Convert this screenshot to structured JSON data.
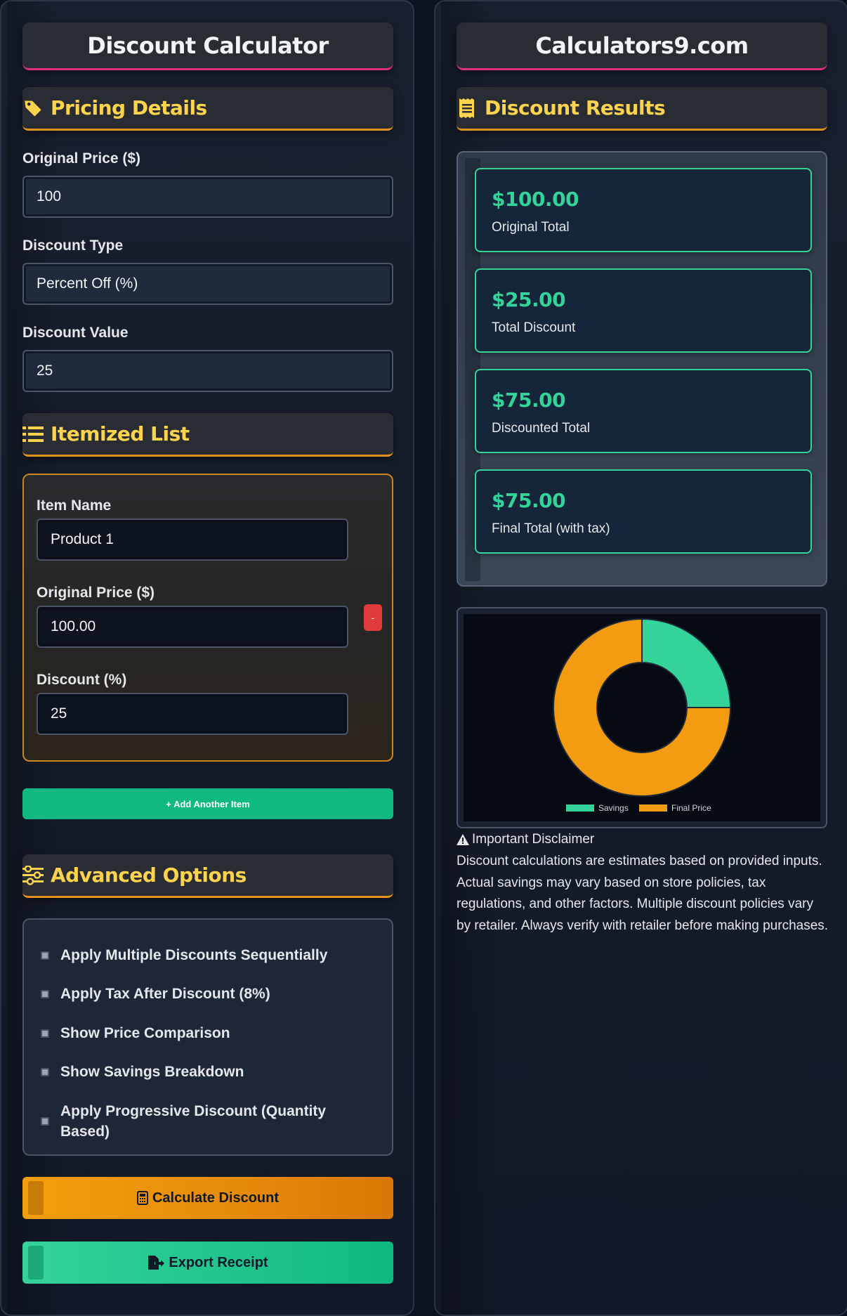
{
  "left": {
    "title": "Discount Calculator",
    "pricing_header": "Pricing Details",
    "original_price_label": "Original Price ($)",
    "original_price_value": "100",
    "discount_type_label": "Discount Type",
    "discount_type_value": "Percent Off (%)",
    "discount_value_label": "Discount Value",
    "discount_value_value": "25",
    "itemized_header": "Itemized List",
    "item": {
      "name_label": "Item Name",
      "name_value": "Product 1",
      "price_label": "Original Price ($)",
      "price_value": "100.00",
      "discount_label": "Discount (%)",
      "discount_value": "25",
      "remove_label": "-"
    },
    "add_item_label": "+ Add Another Item",
    "advanced_header": "Advanced Options",
    "options": [
      "Apply Multiple Discounts Sequentially",
      "Apply Tax After Discount (8%)",
      "Show Price Comparison",
      "Show Savings Breakdown",
      "Apply Progressive Discount (Quantity Based)"
    ],
    "calculate_label": "Calculate Discount",
    "export_label": "Export Receipt"
  },
  "right": {
    "title": "Calculators9.com",
    "results_header": "Discount Results",
    "results": [
      {
        "value": "$100.00",
        "label": "Original Total"
      },
      {
        "value": "$25.00",
        "label": "Total Discount"
      },
      {
        "value": "$75.00",
        "label": "Discounted Total"
      },
      {
        "value": "$75.00",
        "label": "Final Total (with tax)"
      }
    ],
    "disclaimer_title": "Important Disclaimer",
    "disclaimer_text": "Discount calculations are estimates based on provided inputs. Actual savings may vary based on store policies, tax regulations, and other factors. Multiple discount policies vary by retailer. Always verify with retailer before making purchases."
  },
  "colors": {
    "accent_gold": "#fcd34d",
    "accent_green": "#34d399",
    "accent_orange": "#f59e0b",
    "title_underline": "#e0307f"
  },
  "chart_data": {
    "type": "pie",
    "labels": [
      "Savings",
      "Final Price"
    ],
    "values": [
      25,
      75
    ],
    "colors": [
      "#34d399",
      "#f39c12"
    ],
    "legend": "bottom"
  }
}
